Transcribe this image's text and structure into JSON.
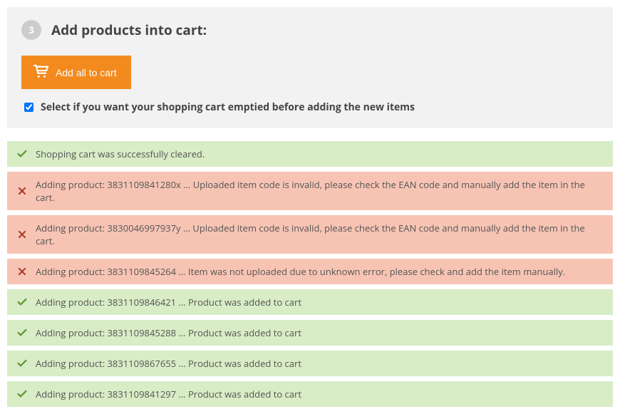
{
  "step": {
    "number": "3",
    "title": "Add products into cart:"
  },
  "button": {
    "label": "Add all to cart"
  },
  "checkbox": {
    "checked": true,
    "label": "Select if you want your shopping cart emptied before adding the new items"
  },
  "messages": [
    {
      "type": "success",
      "text": "Shopping cart was successfully cleared."
    },
    {
      "type": "error",
      "text": "Adding product: 3831109841280x … Uploaded item code is invalid, please check the EAN code and manually add the item in the cart."
    },
    {
      "type": "error",
      "text": "Adding product: 3830046997937y … Uploaded item code is invalid, please check the EAN code and manually add the item in the cart."
    },
    {
      "type": "error",
      "text": "Adding product: 3831109845264 … Item was not uploaded due to unknown error, please check and add the item manually."
    },
    {
      "type": "success",
      "text": "Adding product: 3831109846421 … Product was added to cart"
    },
    {
      "type": "success",
      "text": "Adding product: 3831109845288 … Product was added to cart"
    },
    {
      "type": "success",
      "text": "Adding product: 3831109867655 … Product was added to cart"
    },
    {
      "type": "success",
      "text": "Adding product: 3831109841297 … Product was added to cart"
    }
  ]
}
